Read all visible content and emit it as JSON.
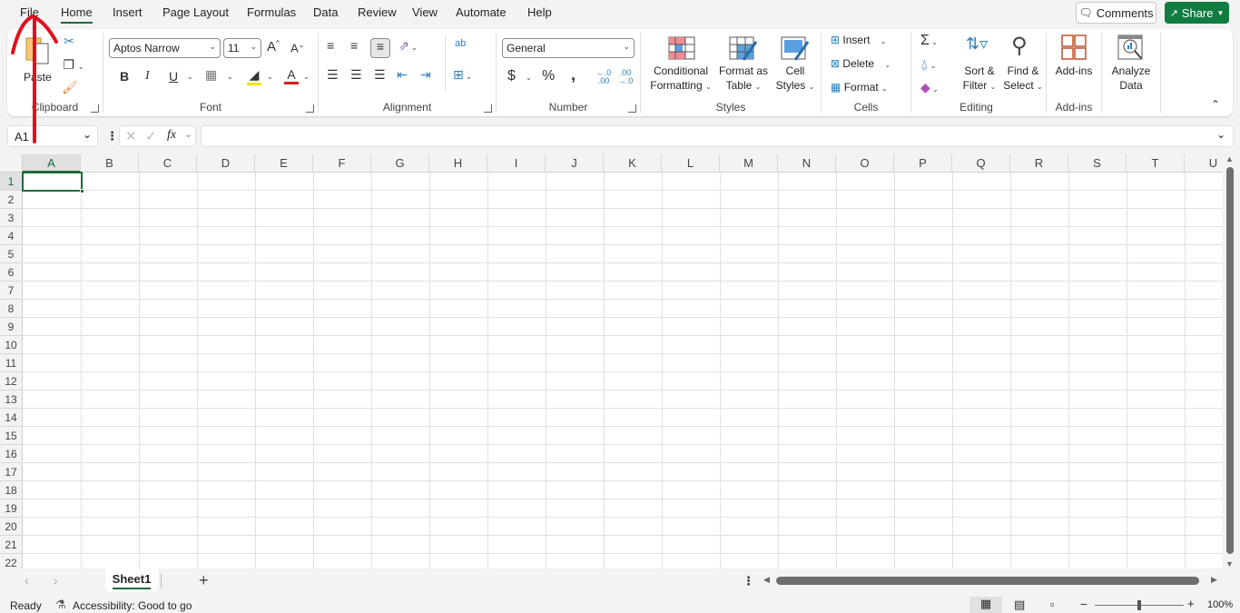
{
  "menu": {
    "tabs": [
      {
        "label": "File"
      },
      {
        "label": "Home",
        "active": true
      },
      {
        "label": "Insert"
      },
      {
        "label": "Page Layout"
      },
      {
        "label": "Formulas"
      },
      {
        "label": "Data"
      },
      {
        "label": "Review"
      },
      {
        "label": "View"
      },
      {
        "label": "Automate"
      },
      {
        "label": "Help"
      }
    ],
    "comments_label": "Comments",
    "share_label": "Share"
  },
  "ribbon": {
    "clipboard": {
      "label": "Clipboard",
      "paste_label": "Paste"
    },
    "font": {
      "label": "Font",
      "font_name": "Aptos Narrow",
      "font_size": "11",
      "bold": "B",
      "italic": "I",
      "underline": "U"
    },
    "alignment": {
      "label": "Alignment"
    },
    "number": {
      "label": "Number",
      "format": "General",
      "currency": "$",
      "percent": "%",
      "comma": ",",
      "inc_decimal": "←.0 .00",
      "dec_decimal": ".00 →.0"
    },
    "styles": {
      "label": "Styles",
      "conditional_formatting": [
        "Conditional",
        "Formatting"
      ],
      "format_as_table": [
        "Format as",
        "Table"
      ],
      "cell_styles": [
        "Cell",
        "Styles"
      ]
    },
    "cells": {
      "label": "Cells",
      "insert": "Insert",
      "delete": "Delete",
      "format": "Format"
    },
    "editing": {
      "label": "Editing",
      "sort_filter": [
        "Sort &",
        "Filter"
      ],
      "find_select": [
        "Find &",
        "Select"
      ]
    },
    "addins": {
      "label": "Add-ins",
      "addins_button": "Add-ins"
    },
    "analyze": {
      "analyze_data": [
        "Analyze",
        "Data"
      ]
    }
  },
  "formula_bar": {
    "name_box": "A1",
    "formula": "",
    "fx": "fx"
  },
  "grid": {
    "columns": [
      "A",
      "B",
      "C",
      "D",
      "E",
      "F",
      "G",
      "H",
      "I",
      "J",
      "K",
      "L",
      "M",
      "N",
      "O",
      "P",
      "Q",
      "R",
      "S",
      "T",
      "U"
    ],
    "rows": [
      "1",
      "2",
      "3",
      "4",
      "5",
      "6",
      "7",
      "8",
      "9",
      "10",
      "11",
      "12",
      "13",
      "14",
      "15",
      "16",
      "17",
      "18",
      "19",
      "20",
      "21",
      "22"
    ],
    "selected_cell": "A1"
  },
  "sheets": {
    "tabs": [
      {
        "label": "Sheet1",
        "active": true
      }
    ],
    "add_label": "+"
  },
  "status": {
    "ready": "Ready",
    "accessibility": "Accessibility: Good to go",
    "zoom": "100%",
    "zoom_level_percent": 100
  },
  "annotation": {
    "color": "#e0101e"
  }
}
